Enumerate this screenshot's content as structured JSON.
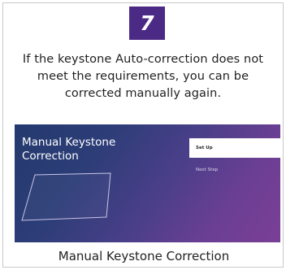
{
  "step": {
    "number": "7"
  },
  "description": "If the keystone Auto-correction does not meet the requirements, you can be corrected manually again.",
  "screen": {
    "title": "Manual Keystone Correction",
    "menu": {
      "setup_label": "Set Up",
      "next_step_label": "Next Step"
    }
  },
  "caption": "Manual Keystone Correction",
  "colors": {
    "badge": "#4b2a86",
    "screen_gradient_start": "#243a6e",
    "screen_gradient_end": "#7a3f96"
  }
}
